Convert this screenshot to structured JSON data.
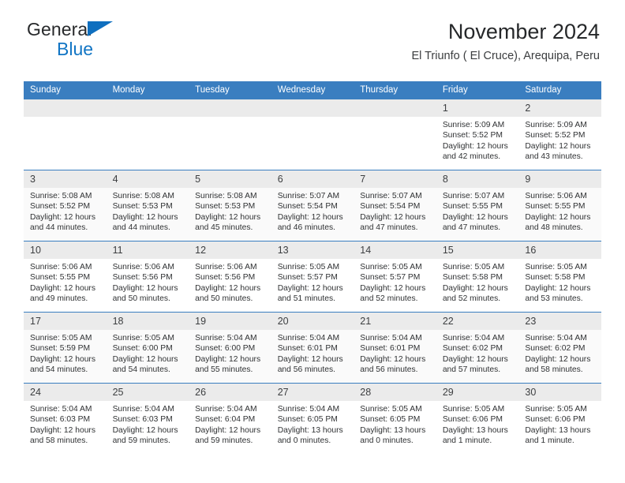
{
  "brand": {
    "name_top": "General",
    "name_bottom": "Blue",
    "accent_color": "#1175c4"
  },
  "header": {
    "title": "November 2024",
    "subtitle": "El Triunfo ( El Cruce), Arequipa, Peru"
  },
  "calendar": {
    "header_bg": "#3a7ec0",
    "weekdays": [
      "Sunday",
      "Monday",
      "Tuesday",
      "Wednesday",
      "Thursday",
      "Friday",
      "Saturday"
    ],
    "weeks": [
      [
        {
          "day": "",
          "empty": true
        },
        {
          "day": "",
          "empty": true
        },
        {
          "day": "",
          "empty": true
        },
        {
          "day": "",
          "empty": true
        },
        {
          "day": "",
          "empty": true
        },
        {
          "day": "1",
          "sunrise": "Sunrise: 5:09 AM",
          "sunset": "Sunset: 5:52 PM",
          "daylight_1": "Daylight: 12 hours",
          "daylight_2": "and 42 minutes."
        },
        {
          "day": "2",
          "sunrise": "Sunrise: 5:09 AM",
          "sunset": "Sunset: 5:52 PM",
          "daylight_1": "Daylight: 12 hours",
          "daylight_2": "and 43 minutes."
        }
      ],
      [
        {
          "day": "3",
          "sunrise": "Sunrise: 5:08 AM",
          "sunset": "Sunset: 5:52 PM",
          "daylight_1": "Daylight: 12 hours",
          "daylight_2": "and 44 minutes."
        },
        {
          "day": "4",
          "sunrise": "Sunrise: 5:08 AM",
          "sunset": "Sunset: 5:53 PM",
          "daylight_1": "Daylight: 12 hours",
          "daylight_2": "and 44 minutes."
        },
        {
          "day": "5",
          "sunrise": "Sunrise: 5:08 AM",
          "sunset": "Sunset: 5:53 PM",
          "daylight_1": "Daylight: 12 hours",
          "daylight_2": "and 45 minutes."
        },
        {
          "day": "6",
          "sunrise": "Sunrise: 5:07 AM",
          "sunset": "Sunset: 5:54 PM",
          "daylight_1": "Daylight: 12 hours",
          "daylight_2": "and 46 minutes."
        },
        {
          "day": "7",
          "sunrise": "Sunrise: 5:07 AM",
          "sunset": "Sunset: 5:54 PM",
          "daylight_1": "Daylight: 12 hours",
          "daylight_2": "and 47 minutes."
        },
        {
          "day": "8",
          "sunrise": "Sunrise: 5:07 AM",
          "sunset": "Sunset: 5:55 PM",
          "daylight_1": "Daylight: 12 hours",
          "daylight_2": "and 47 minutes."
        },
        {
          "day": "9",
          "sunrise": "Sunrise: 5:06 AM",
          "sunset": "Sunset: 5:55 PM",
          "daylight_1": "Daylight: 12 hours",
          "daylight_2": "and 48 minutes."
        }
      ],
      [
        {
          "day": "10",
          "sunrise": "Sunrise: 5:06 AM",
          "sunset": "Sunset: 5:55 PM",
          "daylight_1": "Daylight: 12 hours",
          "daylight_2": "and 49 minutes."
        },
        {
          "day": "11",
          "sunrise": "Sunrise: 5:06 AM",
          "sunset": "Sunset: 5:56 PM",
          "daylight_1": "Daylight: 12 hours",
          "daylight_2": "and 50 minutes."
        },
        {
          "day": "12",
          "sunrise": "Sunrise: 5:06 AM",
          "sunset": "Sunset: 5:56 PM",
          "daylight_1": "Daylight: 12 hours",
          "daylight_2": "and 50 minutes."
        },
        {
          "day": "13",
          "sunrise": "Sunrise: 5:05 AM",
          "sunset": "Sunset: 5:57 PM",
          "daylight_1": "Daylight: 12 hours",
          "daylight_2": "and 51 minutes."
        },
        {
          "day": "14",
          "sunrise": "Sunrise: 5:05 AM",
          "sunset": "Sunset: 5:57 PM",
          "daylight_1": "Daylight: 12 hours",
          "daylight_2": "and 52 minutes."
        },
        {
          "day": "15",
          "sunrise": "Sunrise: 5:05 AM",
          "sunset": "Sunset: 5:58 PM",
          "daylight_1": "Daylight: 12 hours",
          "daylight_2": "and 52 minutes."
        },
        {
          "day": "16",
          "sunrise": "Sunrise: 5:05 AM",
          "sunset": "Sunset: 5:58 PM",
          "daylight_1": "Daylight: 12 hours",
          "daylight_2": "and 53 minutes."
        }
      ],
      [
        {
          "day": "17",
          "sunrise": "Sunrise: 5:05 AM",
          "sunset": "Sunset: 5:59 PM",
          "daylight_1": "Daylight: 12 hours",
          "daylight_2": "and 54 minutes."
        },
        {
          "day": "18",
          "sunrise": "Sunrise: 5:05 AM",
          "sunset": "Sunset: 6:00 PM",
          "daylight_1": "Daylight: 12 hours",
          "daylight_2": "and 54 minutes."
        },
        {
          "day": "19",
          "sunrise": "Sunrise: 5:04 AM",
          "sunset": "Sunset: 6:00 PM",
          "daylight_1": "Daylight: 12 hours",
          "daylight_2": "and 55 minutes."
        },
        {
          "day": "20",
          "sunrise": "Sunrise: 5:04 AM",
          "sunset": "Sunset: 6:01 PM",
          "daylight_1": "Daylight: 12 hours",
          "daylight_2": "and 56 minutes."
        },
        {
          "day": "21",
          "sunrise": "Sunrise: 5:04 AM",
          "sunset": "Sunset: 6:01 PM",
          "daylight_1": "Daylight: 12 hours",
          "daylight_2": "and 56 minutes."
        },
        {
          "day": "22",
          "sunrise": "Sunrise: 5:04 AM",
          "sunset": "Sunset: 6:02 PM",
          "daylight_1": "Daylight: 12 hours",
          "daylight_2": "and 57 minutes."
        },
        {
          "day": "23",
          "sunrise": "Sunrise: 5:04 AM",
          "sunset": "Sunset: 6:02 PM",
          "daylight_1": "Daylight: 12 hours",
          "daylight_2": "and 58 minutes."
        }
      ],
      [
        {
          "day": "24",
          "sunrise": "Sunrise: 5:04 AM",
          "sunset": "Sunset: 6:03 PM",
          "daylight_1": "Daylight: 12 hours",
          "daylight_2": "and 58 minutes."
        },
        {
          "day": "25",
          "sunrise": "Sunrise: 5:04 AM",
          "sunset": "Sunset: 6:03 PM",
          "daylight_1": "Daylight: 12 hours",
          "daylight_2": "and 59 minutes."
        },
        {
          "day": "26",
          "sunrise": "Sunrise: 5:04 AM",
          "sunset": "Sunset: 6:04 PM",
          "daylight_1": "Daylight: 12 hours",
          "daylight_2": "and 59 minutes."
        },
        {
          "day": "27",
          "sunrise": "Sunrise: 5:04 AM",
          "sunset": "Sunset: 6:05 PM",
          "daylight_1": "Daylight: 13 hours",
          "daylight_2": "and 0 minutes."
        },
        {
          "day": "28",
          "sunrise": "Sunrise: 5:05 AM",
          "sunset": "Sunset: 6:05 PM",
          "daylight_1": "Daylight: 13 hours",
          "daylight_2": "and 0 minutes."
        },
        {
          "day": "29",
          "sunrise": "Sunrise: 5:05 AM",
          "sunset": "Sunset: 6:06 PM",
          "daylight_1": "Daylight: 13 hours",
          "daylight_2": "and 1 minute."
        },
        {
          "day": "30",
          "sunrise": "Sunrise: 5:05 AM",
          "sunset": "Sunset: 6:06 PM",
          "daylight_1": "Daylight: 13 hours",
          "daylight_2": "and 1 minute."
        }
      ]
    ]
  }
}
